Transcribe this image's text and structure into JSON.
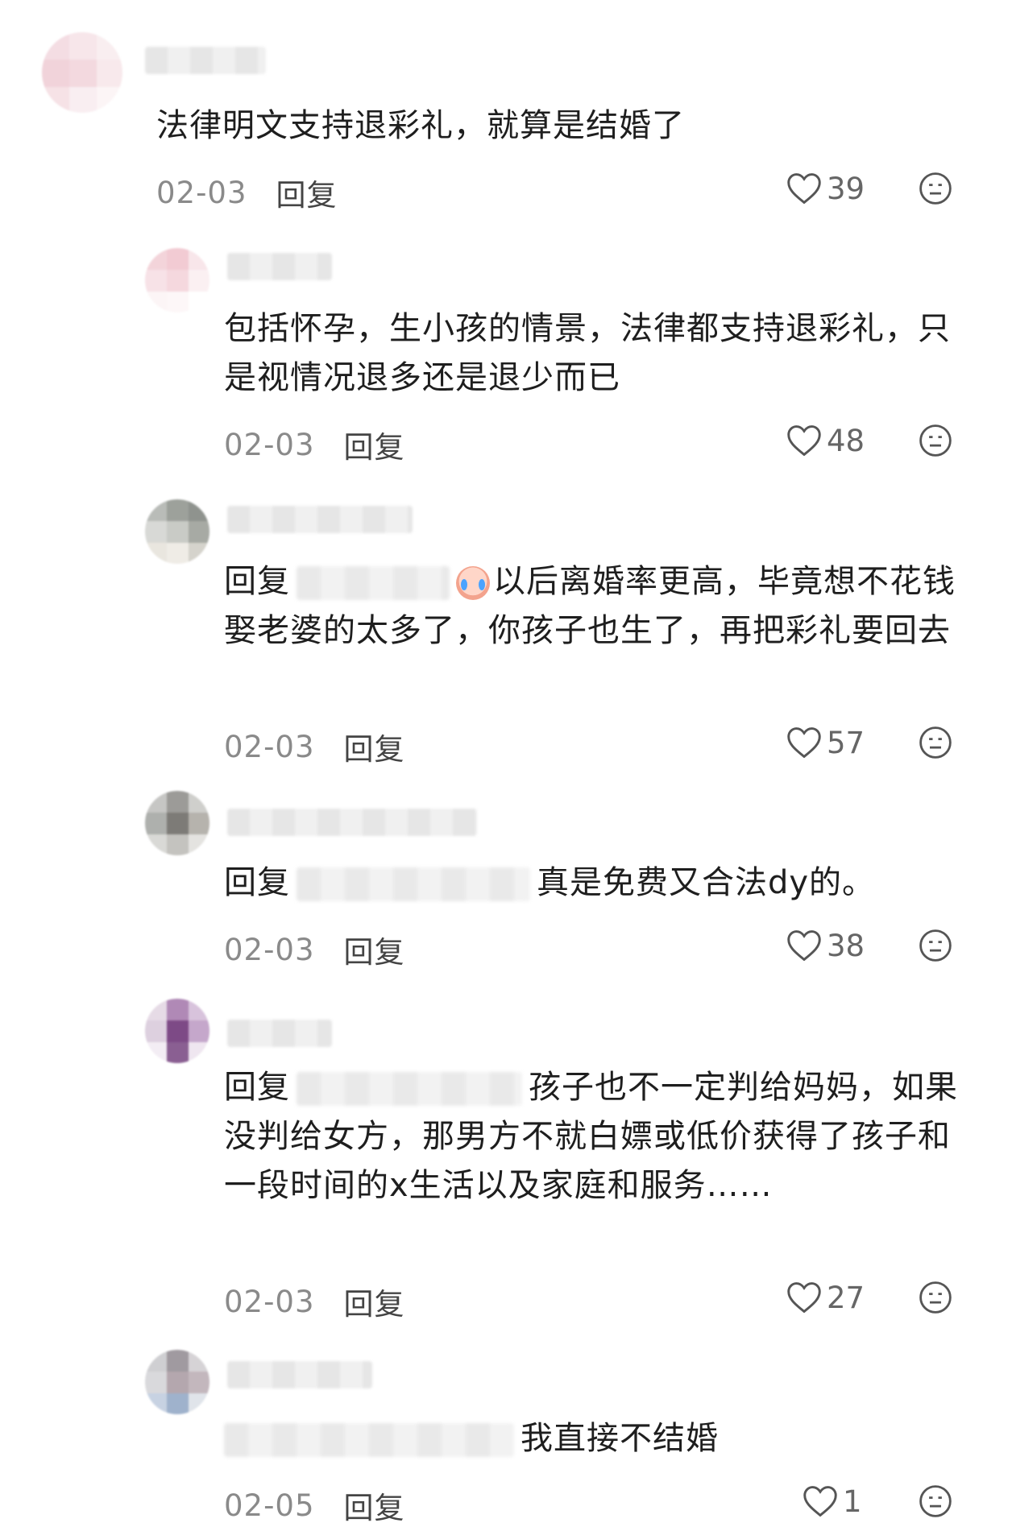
{
  "comments": [
    {
      "text": "法律明文支持退彩礼，就算是结婚了",
      "date": "02-03",
      "reply": "回复",
      "likes": "39"
    },
    {
      "text": "包括怀孕，生小孩的情景，法律都支持退彩礼，只是视情况退多还是退少而已",
      "date": "02-03",
      "reply": "回复",
      "likes": "48"
    },
    {
      "prefix": "回复",
      "text": "以后离婚率更高，毕竟想不花钱娶老婆的太多了，你孩子也生了，再把彩礼要回去",
      "date": "02-03",
      "reply": "回复",
      "likes": "57"
    },
    {
      "prefix": "回复",
      "text": "真是免费又合法dy的。",
      "date": "02-03",
      "reply": "回复",
      "likes": "38"
    },
    {
      "prefix": "回复",
      "text": "孩子也不一定判给妈妈，如果没判给女方，那男方不就白嫖或低价获得了孩子和一段时间的x生活以及家庭和服务……",
      "date": "02-03",
      "reply": "回复",
      "likes": "27"
    },
    {
      "text": "我直接不结婚",
      "date": "02-05",
      "reply": "回复",
      "likes": "1"
    }
  ],
  "icons": {
    "like": "heart-outline-icon",
    "dislike": "meh-face-icon"
  },
  "colors": {
    "text": "#1e1e1e",
    "date": "#8a8a8a",
    "icon": "#555555"
  }
}
